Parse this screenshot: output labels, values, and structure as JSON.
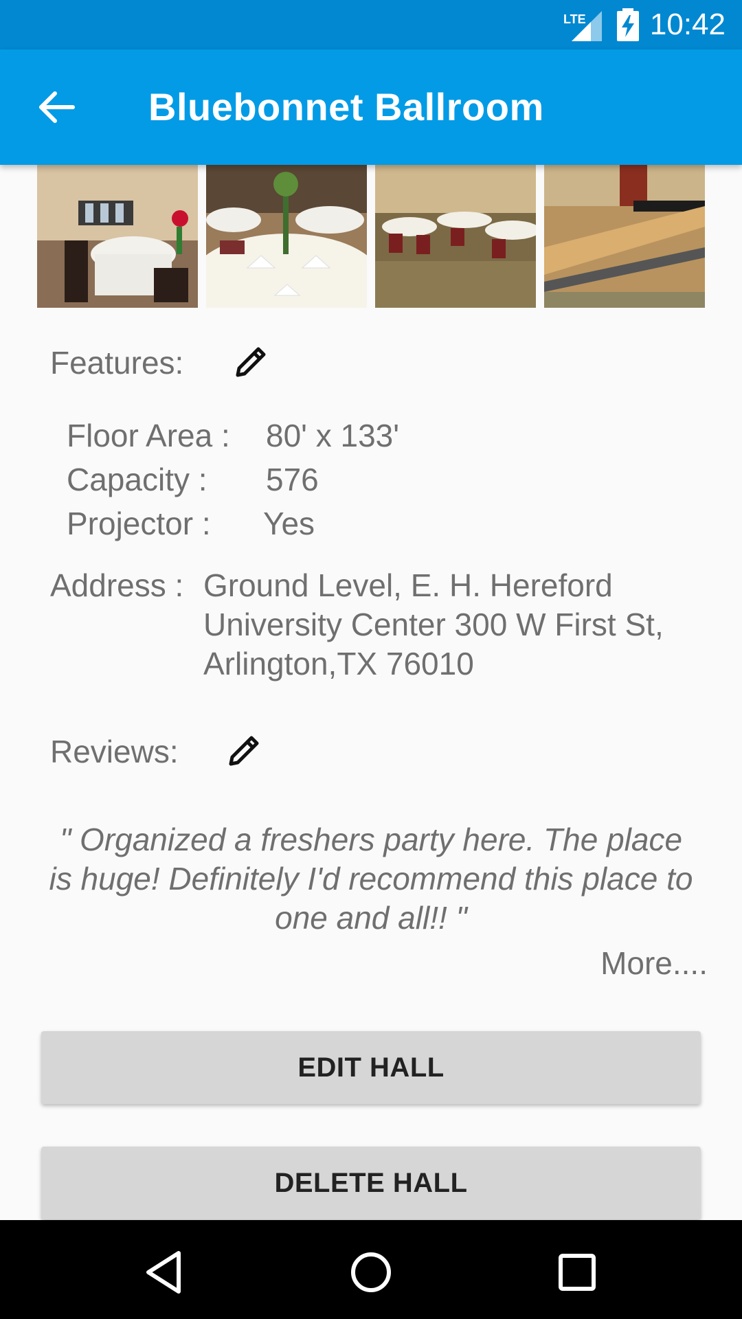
{
  "status_bar": {
    "time": "10:42",
    "network": "LTE",
    "icons": [
      "lte-signal-icon",
      "battery-charging-icon"
    ]
  },
  "app_bar": {
    "title": "Bluebonnet Ballroom",
    "back_icon": "arrow-back-icon"
  },
  "gallery": {
    "photos": [
      "ballroom-photo-1",
      "ballroom-photo-2",
      "ballroom-photo-3",
      "ballroom-photo-4"
    ]
  },
  "features": {
    "label": "Features:",
    "edit_icon": "pencil-icon",
    "items": [
      {
        "label": "Floor Area :",
        "value": "80' x 133'"
      },
      {
        "label": "Capacity :",
        "value": "576"
      },
      {
        "label": "Projector :",
        "value": "Yes"
      }
    ]
  },
  "address": {
    "label": "Address :",
    "lines": [
      "Ground Level, E. H. Hereford",
      "University Center 300 W First St,",
      "Arlington,TX 76010"
    ]
  },
  "reviews": {
    "label": "Reviews:",
    "edit_icon": "pencil-icon",
    "quote_lines": [
      " \" Organized a freshers party here. The place",
      "is huge! Definitely I'd recommend this place to",
      "one and all!!  \""
    ],
    "more": "More...."
  },
  "actions": {
    "edit": "EDIT HALL",
    "delete": "DELETE HALL"
  },
  "nav_bar": {
    "icons": [
      "back-triangle-icon",
      "home-circle-icon",
      "recents-square-icon"
    ]
  },
  "colors": {
    "status_bar": "#0288d1",
    "app_bar": "#039be5",
    "button": "#d6d6d6"
  }
}
